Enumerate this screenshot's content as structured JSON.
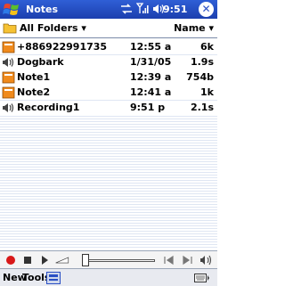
{
  "titlebar": {
    "app_title": "Notes",
    "clock": "9:51",
    "close_glyph": "✕"
  },
  "folderbar": {
    "folder_label": "All Folders ▾",
    "sort_label": "Name ▾"
  },
  "rows": [
    {
      "type": "note-icon",
      "name": "+886922991735",
      "time": "12:55 a",
      "size": "6k"
    },
    {
      "type": "recording-icon",
      "name": "Dogbark",
      "time": "1/31/05",
      "size": "1.9s"
    },
    {
      "type": "note-icon",
      "name": "Note1",
      "time": "12:39 a",
      "size": "754b"
    },
    {
      "type": "note-icon",
      "name": "Note2",
      "time": "12:41 a",
      "size": "1k"
    },
    {
      "type": "recording-icon",
      "name": "Recording1",
      "time": "9:51 p",
      "size": "2.1s"
    }
  ],
  "menubar": {
    "new_label": "New",
    "tools_label": "Tools"
  },
  "colors": {
    "titlebar": "#2a4fc4",
    "note_icon": "#f08a1c",
    "record_red": "#d81818"
  }
}
